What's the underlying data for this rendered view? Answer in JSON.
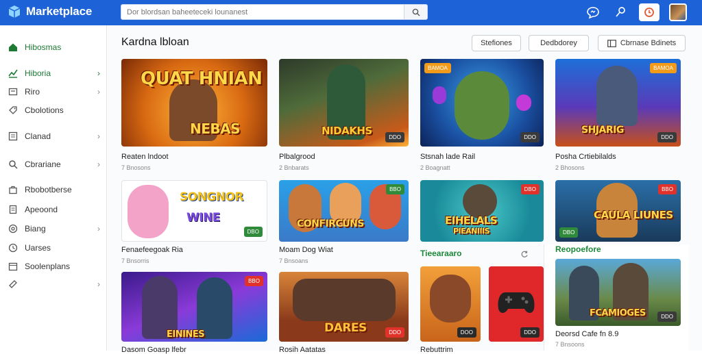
{
  "app": {
    "title": "Marketplace"
  },
  "search": {
    "placeholder": "Dor blordsan baheeteceki lounanest"
  },
  "sidebar": {
    "items": [
      {
        "label": "Hibosmas",
        "icon": "home-icon",
        "chevron": false,
        "active": true
      },
      {
        "label": "Hiboria",
        "icon": "trend-icon",
        "chevron": true,
        "active": true
      },
      {
        "label": "Riro",
        "icon": "box-icon",
        "chevron": true,
        "active": false
      },
      {
        "label": "Cbolotions",
        "icon": "tag-icon",
        "chevron": false,
        "active": false
      },
      {
        "label": "Clanad",
        "icon": "list-icon",
        "chevron": true,
        "active": false
      },
      {
        "label": "Cbrariane",
        "icon": "search-icon",
        "chevron": true,
        "active": false
      },
      {
        "label": "Rbobotberse",
        "icon": "bag-icon",
        "chevron": false,
        "active": false
      },
      {
        "label": "Apeoond",
        "icon": "doc-icon",
        "chevron": false,
        "active": false
      },
      {
        "label": "Biang",
        "icon": "settings-icon",
        "chevron": true,
        "active": false
      },
      {
        "label": "Uarses",
        "icon": "clock-icon",
        "chevron": false,
        "active": false
      },
      {
        "label": "Soolenplans",
        "icon": "calendar-icon",
        "chevron": false,
        "active": false
      },
      {
        "label": "",
        "icon": "tag-icon",
        "chevron": true,
        "active": false
      }
    ]
  },
  "header": {
    "title": "Kardna lbloan",
    "buttons": [
      "Stefiones",
      "Dedbdorey",
      "Cbrnase Bdinets"
    ]
  },
  "cards": [
    {
      "name": "Reaten lndoot",
      "sub": "7 Bnosons",
      "art": "QUAT HNIAN",
      "art2": "NEBAS",
      "badge": "",
      "tag": ""
    },
    {
      "name": "Plbalgrood",
      "sub": "2 Bnbarats",
      "art": "NIDAKHS",
      "art2": "",
      "badge": "DDO",
      "tag": ""
    },
    {
      "name": "Stsnah lade Rail",
      "sub": "2 Boagnatt",
      "art": "",
      "art2": "",
      "badge": "DDO",
      "tag": "BAMOA"
    },
    {
      "name": "Posha Crtiebilalds",
      "sub": "2 Bhosons",
      "art": "SHJARIG",
      "art2": "",
      "badge": "DDO",
      "tag": "BAMOA"
    },
    {
      "name": "Fenaefeegoak Ria",
      "sub": "7 Bnsorris",
      "art": "SONGNOR",
      "art2": "WINE",
      "badge": "DBO",
      "tag": ""
    },
    {
      "name": "Moam Dog Wiat",
      "sub": "7 Bnsoans",
      "art": "CONFIRCUNS",
      "art2": "",
      "badge": "",
      "tag": "BBO"
    },
    {
      "name": "",
      "sub": "",
      "art": "EIHELALS",
      "art2": "PIEANIIIS",
      "badge": "",
      "tag": "DBO"
    },
    {
      "name": "",
      "sub": "",
      "art": "CAULA LIUNES",
      "art2": "",
      "badge": "DBO",
      "tag": "BBO"
    },
    {
      "name": "Dasom Goasp lfebr",
      "sub": "",
      "art": "EININES",
      "art2": "",
      "badge": "",
      "tag": "BBO"
    },
    {
      "name": "Rosih Aatatas",
      "sub": "",
      "art": "DARES",
      "art2": "",
      "badge": "DDO",
      "tag": ""
    },
    {
      "name": "Rebuttrim",
      "sub": "",
      "art": "",
      "art2": "",
      "badge": "DOO",
      "tag": ""
    },
    {
      "name": "",
      "sub": "",
      "art": "",
      "art2": "",
      "badge": "DDO",
      "tag": ""
    },
    {
      "name": "Deorsd Cafe fn 8.9",
      "sub": "7 Bnsoons",
      "art": "FCAMIOGES",
      "art2": "",
      "badge": "DDO",
      "tag": ""
    }
  ],
  "sections": {
    "left": "Tieearaaro",
    "right": "Reopoefore"
  },
  "colors": {
    "brand": "#1e62d8",
    "accent_green": "#1c8a3a",
    "tag_red": "#e0312b"
  }
}
